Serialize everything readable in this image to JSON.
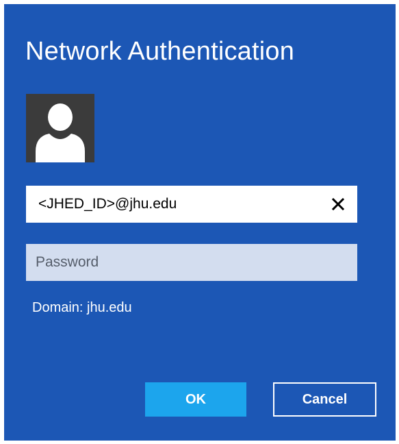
{
  "dialog": {
    "title": "Network Authentication",
    "colors": {
      "background": "#1c57b5",
      "accent": "#1ca5ed",
      "text": "#ffffff"
    }
  },
  "avatar": {
    "icon": "user-silhouette-icon"
  },
  "username": {
    "value": "<JHED_ID>@jhu.edu",
    "clear_icon": "close-icon"
  },
  "password": {
    "value": "",
    "placeholder": "Password"
  },
  "domain_text": "Domain: jhu.edu",
  "buttons": {
    "ok": "OK",
    "cancel": "Cancel"
  }
}
